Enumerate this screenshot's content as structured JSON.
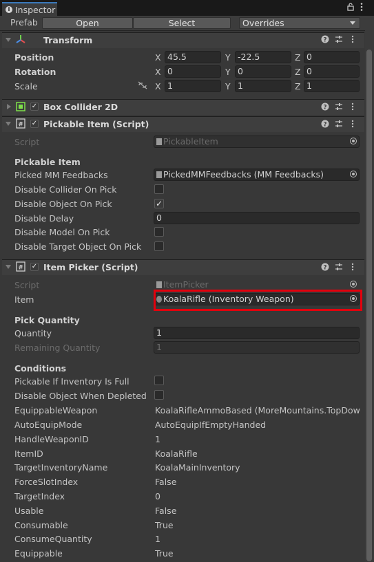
{
  "window": {
    "tab_label": "Inspector",
    "lock_icon": "lock-icon",
    "menu_icon": "kebab-menu-icon"
  },
  "prefab": {
    "label": "Prefab",
    "open": "Open",
    "select": "Select",
    "overrides": "Overrides"
  },
  "transform": {
    "title": "Transform",
    "position": {
      "label": "Position",
      "x": "45.5",
      "y": "-22.5",
      "z": "0"
    },
    "rotation": {
      "label": "Rotation",
      "x": "0",
      "y": "0",
      "z": "0"
    },
    "scale": {
      "label": "Scale",
      "x": "1",
      "y": "1",
      "z": "1"
    },
    "axes": {
      "x": "X",
      "y": "Y",
      "z": "Z"
    }
  },
  "box_collider": {
    "title": "Box Collider 2D"
  },
  "pickable_item": {
    "title": "Pickable Item (Script)",
    "script_label": "Script",
    "script_value": "PickableItem",
    "section": "Pickable Item",
    "picked_feedbacks_label": "Picked MM Feedbacks",
    "picked_feedbacks_value": "PickedMMFeedbacks (MM Feedbacks)",
    "disable_collider_label": "Disable Collider On Pick",
    "disable_object_label": "Disable Object On Pick",
    "disable_delay_label": "Disable Delay",
    "disable_delay_value": "0",
    "disable_model_label": "Disable Model On Pick",
    "disable_target_label": "Disable Target Object On Pick"
  },
  "item_picker": {
    "title": "Item Picker (Script)",
    "script_label": "Script",
    "script_value": "ItemPicker",
    "item_label": "Item",
    "item_value": "KoalaRifle (Inventory Weapon)",
    "pick_quantity_section": "Pick Quantity",
    "quantity_label": "Quantity",
    "quantity_value": "1",
    "remaining_label": "Remaining Quantity",
    "remaining_value": "1",
    "conditions_section": "Conditions",
    "pickable_full_label": "Pickable If Inventory Is Full",
    "disable_depleted_label": "Disable Object When Depleted",
    "rows": [
      {
        "label": "EquippableWeapon",
        "value": "KoalaRifleAmmoBased (MoreMountains.TopDown"
      },
      {
        "label": "AutoEquipMode",
        "value": "AutoEquipIfEmptyHanded"
      },
      {
        "label": "HandleWeaponID",
        "value": "1"
      },
      {
        "label": "ItemID",
        "value": "KoalaRifle"
      },
      {
        "label": "TargetInventoryName",
        "value": "KoalaMainInventory"
      },
      {
        "label": "ForceSlotIndex",
        "value": "False"
      },
      {
        "label": "TargetIndex",
        "value": "0"
      },
      {
        "label": "Usable",
        "value": "False"
      },
      {
        "label": "Consumable",
        "value": "True"
      },
      {
        "label": "ConsumeQuantity",
        "value": "1"
      },
      {
        "label": "Equippable",
        "value": "True"
      }
    ]
  },
  "colors": {
    "highlight": "#e3000d",
    "accent": "#3a79bb"
  }
}
